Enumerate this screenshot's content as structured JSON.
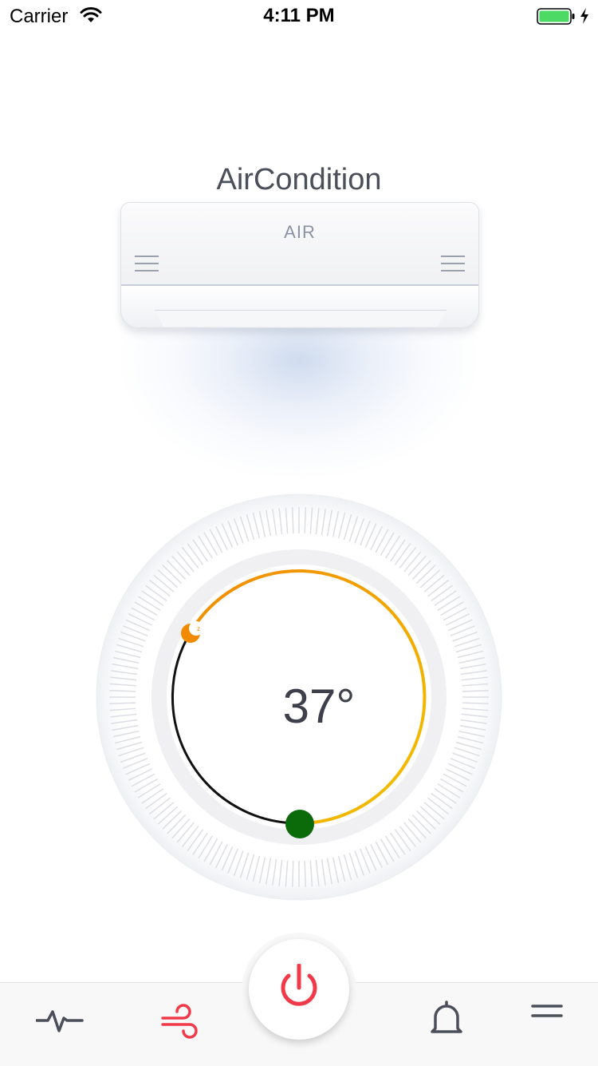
{
  "status_bar": {
    "carrier": "Carrier",
    "time": "4:11 PM",
    "battery_color": "#4cd964"
  },
  "header": {
    "title": "AirCondition"
  },
  "device": {
    "label": "AIR"
  },
  "thermostat": {
    "temperature": "37°",
    "arc_start_color": "#f28a00",
    "arc_end_color": "#f2c200",
    "knob_color": "#0b6b0b"
  },
  "tab_bar": {
    "items": [
      {
        "icon": "pulse-icon",
        "color": "#4a4f5a"
      },
      {
        "icon": "wind-icon",
        "color": "#f03a4a",
        "active": true
      },
      {
        "icon": "power-icon",
        "color": "#f03a4a"
      },
      {
        "icon": "bell-icon",
        "color": "#4a4f5a"
      },
      {
        "icon": "menu-icon",
        "color": "#4a4f5a"
      }
    ]
  }
}
